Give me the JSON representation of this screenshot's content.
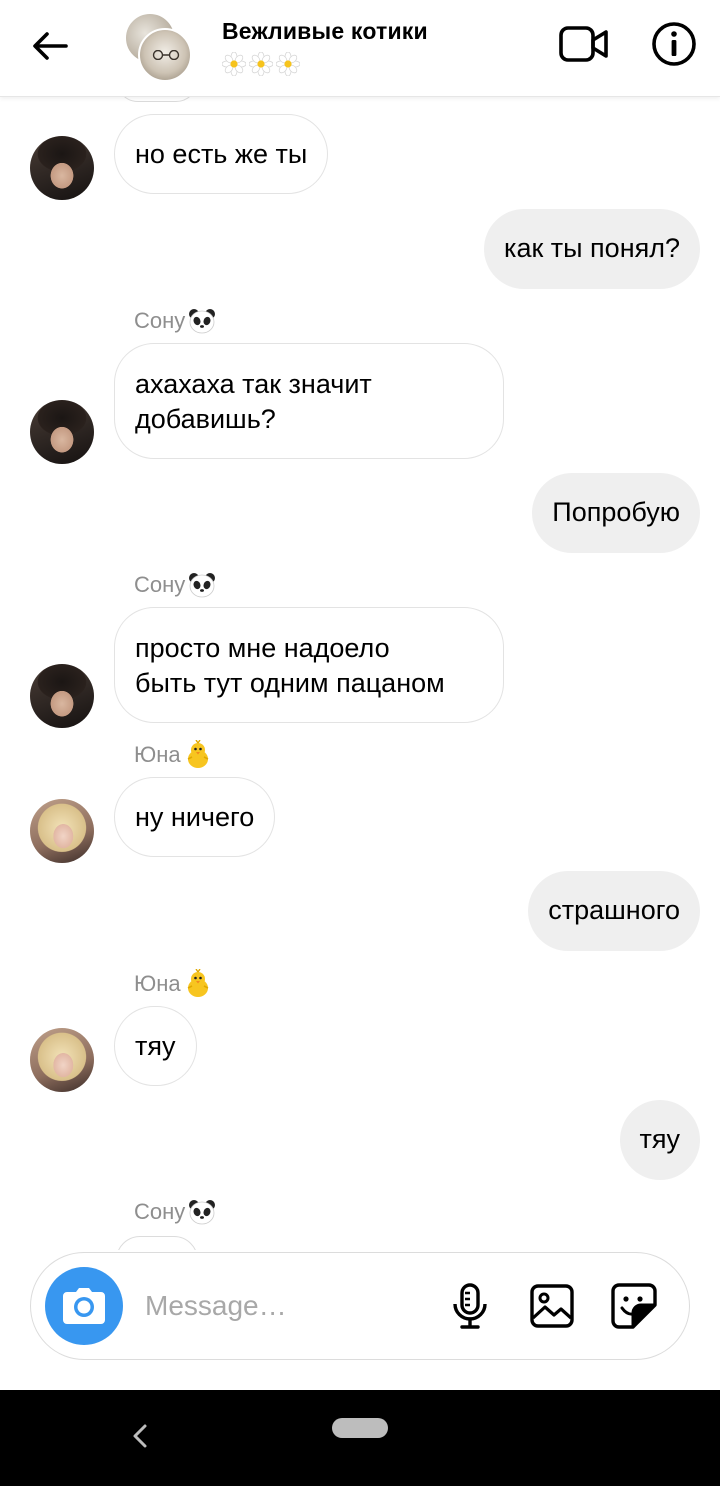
{
  "header": {
    "title": "Вежливые котики",
    "subtitle_icons": [
      "daisy-icon",
      "daisy-icon",
      "daisy-icon"
    ]
  },
  "messages": [
    {
      "side": "in",
      "sender_avatar": "sony",
      "text": "но есть же ты"
    },
    {
      "side": "out",
      "text": "как ты понял?"
    },
    {
      "side": "in",
      "sender": "Сону",
      "sender_emoji": "panda-icon",
      "sender_avatar": "sony",
      "text": "ахахаха так значит\nдобавишь?"
    },
    {
      "side": "out",
      "text": "Попробую"
    },
    {
      "side": "in",
      "sender": "Сону",
      "sender_emoji": "panda-icon",
      "sender_avatar": "sony",
      "text": "просто мне надоело\nбыть тут одним пацаном"
    },
    {
      "side": "in",
      "sender": "Юна",
      "sender_emoji": "chick-icon",
      "sender_avatar": "yuna",
      "text": "ну ничего"
    },
    {
      "side": "out",
      "text": "страшного"
    },
    {
      "side": "in",
      "sender": "Юна",
      "sender_emoji": "chick-icon",
      "sender_avatar": "yuna",
      "text": "тяу"
    },
    {
      "side": "out",
      "text": "тяу"
    },
    {
      "side": "in",
      "sender": "Сону",
      "sender_emoji": "panda-icon",
      "sender_avatar": "sony",
      "text": ""
    }
  ],
  "composer": {
    "placeholder": "Message…",
    "value": ""
  },
  "colors": {
    "accent": "#3897f0",
    "outgoing_bubble": "#efefef",
    "incoming_border": "#e3e3e3",
    "sender_name": "#8e8e8e",
    "nav_bar": "#000000"
  }
}
